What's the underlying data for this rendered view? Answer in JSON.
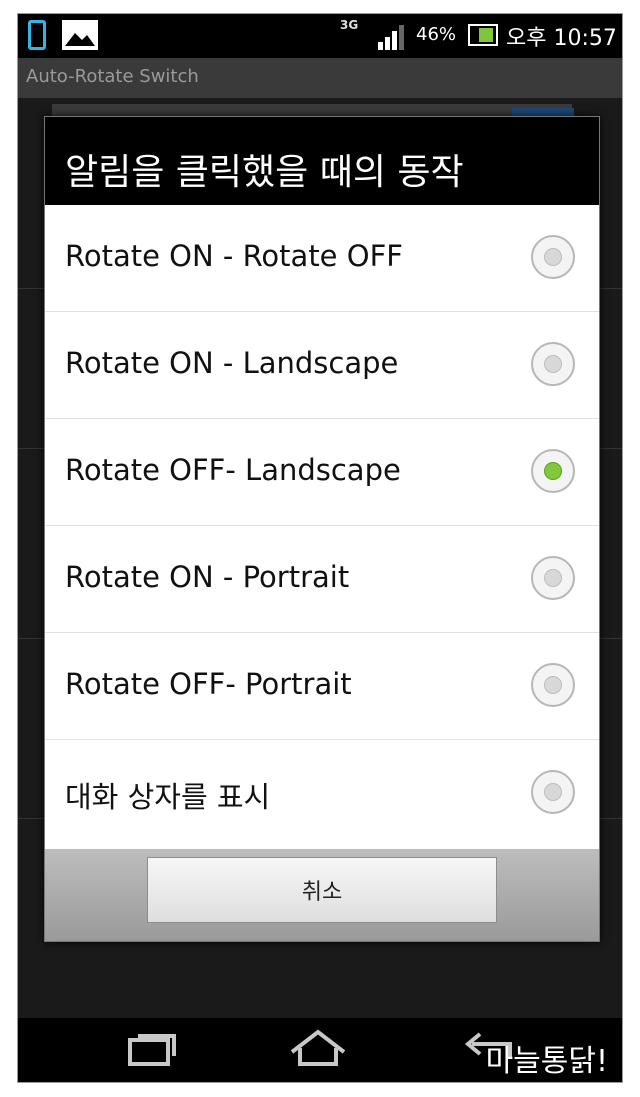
{
  "status_bar": {
    "network": "3G",
    "battery_percent": "46%",
    "time": "오후 10:57"
  },
  "app": {
    "title": "Auto-Rotate Switch"
  },
  "dialog": {
    "title": "알림을 클릭했을 때의 동작",
    "options": [
      {
        "label": "Rotate ON - Rotate OFF",
        "selected": false
      },
      {
        "label": "Rotate ON - Landscape",
        "selected": false
      },
      {
        "label": "Rotate OFF- Landscape",
        "selected": true
      },
      {
        "label": "Rotate ON - Portrait",
        "selected": false
      },
      {
        "label": "Rotate OFF- Portrait",
        "selected": false
      },
      {
        "label": "대화 상자를 표시",
        "selected": false
      }
    ],
    "cancel_label": "취소"
  },
  "nav": {
    "icons": [
      "recent-apps-icon",
      "home-icon",
      "back-icon"
    ]
  },
  "watermark": "마늘통닭!",
  "colors": {
    "accent_green": "#82c73c",
    "status_blue": "#33b5e5"
  }
}
